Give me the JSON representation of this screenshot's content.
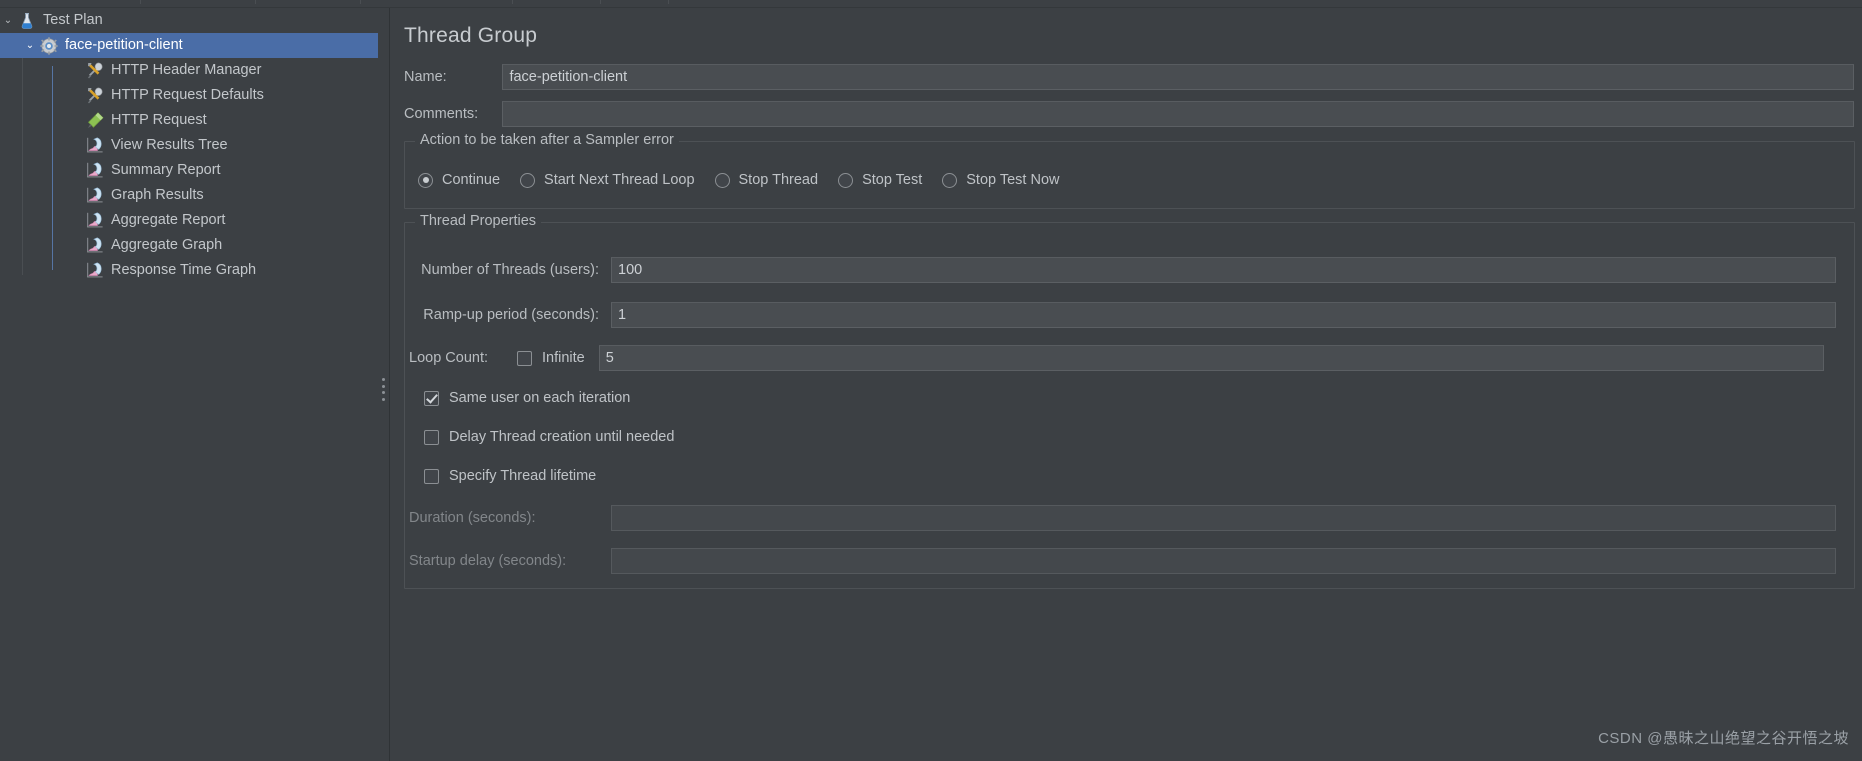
{
  "app": {
    "accent_color": "#4a6da7",
    "background_color": "#3c4044",
    "field_background": "#494d51",
    "text_color": "#bfc3c7"
  },
  "tree": {
    "items": [
      {
        "label": "Test Plan",
        "icon": "test-plan-icon",
        "depth": 0,
        "twisty": "⌄",
        "selected": false
      },
      {
        "label": "face-petition-client",
        "icon": "thread-group-icon",
        "depth": 1,
        "twisty": "⌄",
        "selected": true
      },
      {
        "label": "HTTP Header Manager",
        "icon": "config-element-icon",
        "depth": 2,
        "twisty": "",
        "selected": false
      },
      {
        "label": "HTTP Request Defaults",
        "icon": "config-element-icon",
        "depth": 2,
        "twisty": "",
        "selected": false
      },
      {
        "label": "HTTP Request",
        "icon": "http-sampler-icon",
        "depth": 2,
        "twisty": "",
        "selected": false
      },
      {
        "label": "View Results Tree",
        "icon": "listener-icon",
        "depth": 2,
        "twisty": "",
        "selected": false
      },
      {
        "label": "Summary Report",
        "icon": "listener-icon",
        "depth": 2,
        "twisty": "",
        "selected": false
      },
      {
        "label": "Graph Results",
        "icon": "listener-icon",
        "depth": 2,
        "twisty": "",
        "selected": false
      },
      {
        "label": "Aggregate Report",
        "icon": "listener-icon",
        "depth": 2,
        "twisty": "",
        "selected": false
      },
      {
        "label": "Aggregate Graph",
        "icon": "listener-icon",
        "depth": 2,
        "twisty": "",
        "selected": false
      },
      {
        "label": "Response Time Graph",
        "icon": "listener-icon",
        "depth": 2,
        "twisty": "",
        "selected": false
      }
    ]
  },
  "detail": {
    "title": "Thread Group",
    "name_label": "Name:",
    "name_value": "face-petition-client",
    "comments_label": "Comments:",
    "comments_value": "",
    "sampler_error_group": {
      "title": "Action to be taken after a Sampler error",
      "options": [
        {
          "label": "Continue",
          "checked": true
        },
        {
          "label": "Start Next Thread Loop",
          "checked": false
        },
        {
          "label": "Stop Thread",
          "checked": false
        },
        {
          "label": "Stop Test",
          "checked": false
        },
        {
          "label": "Stop Test Now",
          "checked": false
        }
      ]
    },
    "thread_properties": {
      "title": "Thread Properties",
      "num_threads_label": "Number of Threads (users):",
      "num_threads_value": "100",
      "rampup_label": "Ramp-up period (seconds):",
      "rampup_value": "1",
      "loop_count_label": "Loop Count:",
      "loop_infinite_label": "Infinite",
      "loop_infinite_checked": false,
      "loop_count_value": "5",
      "same_user_label": "Same user on each iteration",
      "same_user_checked": true,
      "delay_thread_label": "Delay Thread creation until needed",
      "delay_thread_checked": false,
      "specify_lifetime_label": "Specify Thread lifetime",
      "specify_lifetime_checked": false,
      "duration_label": "Duration (seconds):",
      "duration_value": "",
      "startup_delay_label": "Startup delay (seconds):",
      "startup_delay_value": ""
    }
  },
  "watermark": "CSDN @愚昧之山绝望之谷开悟之坡"
}
